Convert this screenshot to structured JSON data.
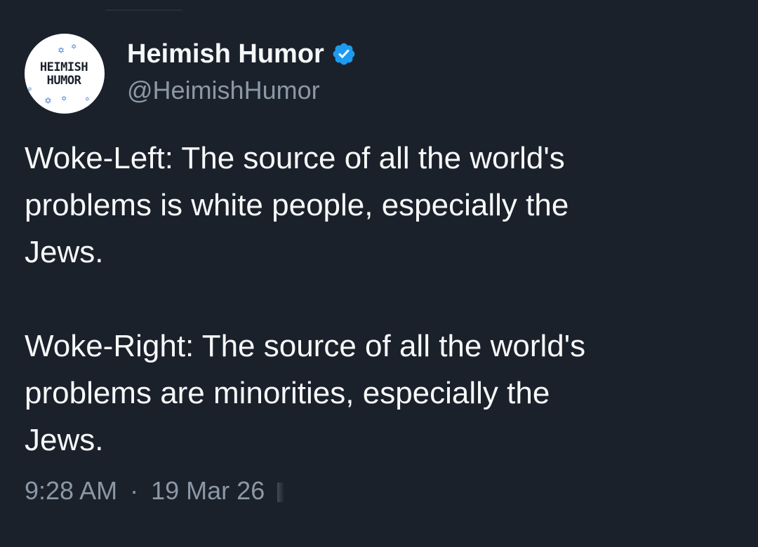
{
  "account": {
    "display_name": "Heimish Humor",
    "handle": "@HeimishHumor",
    "verified": true,
    "avatar": {
      "line1": "HEIMISH",
      "line2": "HUMOR",
      "icon": "star-of-david-icon"
    }
  },
  "tweet": {
    "lines": [
      "Woke-Left: The source of all the world's",
      "problems is white people, especially the",
      "Jews.",
      "",
      "Woke-Right: The source of all the world's",
      "problems are minorities, especially the",
      "Jews."
    ]
  },
  "meta": {
    "time": "9:28 AM",
    "separator": "·",
    "date": "19 Mar 26"
  },
  "colors": {
    "background": "#1b212b",
    "text": "#f7f9f9",
    "secondary_text": "#8b98a5",
    "verified_blue": "#1d9bf0"
  }
}
